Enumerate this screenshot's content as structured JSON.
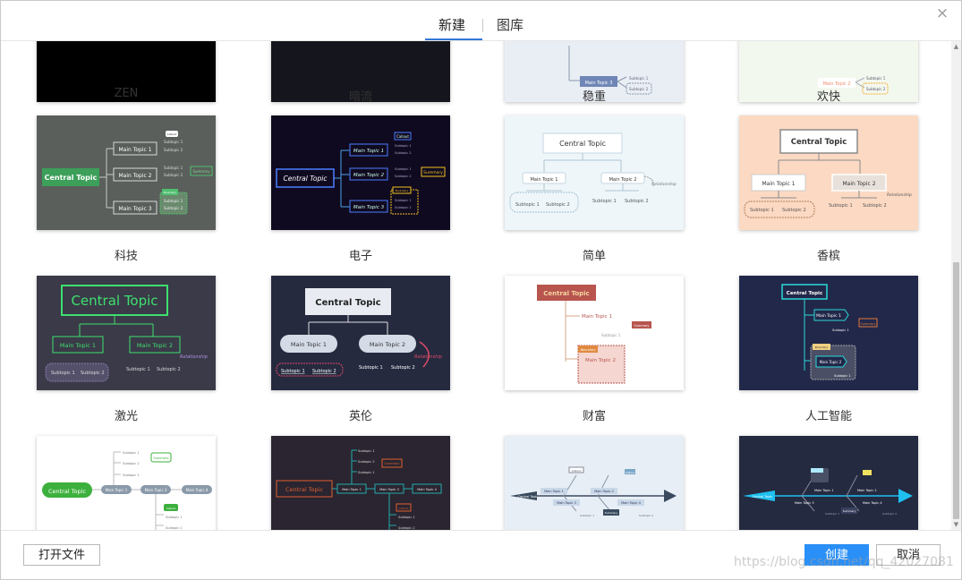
{
  "header": {
    "tabs": [
      {
        "label": "新建",
        "active": true
      },
      {
        "label": "图库",
        "active": false
      }
    ],
    "close_icon": "×"
  },
  "themes": [
    {
      "name": "ZEN"
    },
    {
      "name": "暗流"
    },
    {
      "name": "稳重"
    },
    {
      "name": "欢快"
    },
    {
      "name": "科技"
    },
    {
      "name": "电子"
    },
    {
      "name": "简单"
    },
    {
      "name": "香槟"
    },
    {
      "name": "激光"
    },
    {
      "name": "英伦"
    },
    {
      "name": "财富"
    },
    {
      "name": "人工智能"
    }
  ],
  "preview_text": {
    "central": "Central Topic",
    "main1": "Main Topic 1",
    "main2": "Main Topic 2",
    "main3": "Main Topic 3",
    "main4": "Main Topic 4",
    "sub1": "Subtopic 1",
    "sub2": "Subtopic 2",
    "summary": "Summary",
    "callout": "Callout",
    "boundary": "Boundary",
    "relationship": "Relationship"
  },
  "footer": {
    "open_file": "打开文件",
    "create": "创建",
    "cancel": "取消"
  },
  "watermark": "https://blog.csdn.net/qq_42027081",
  "colors": {
    "accent": "#2a8ff7",
    "tab_underline": "#3478d6"
  }
}
